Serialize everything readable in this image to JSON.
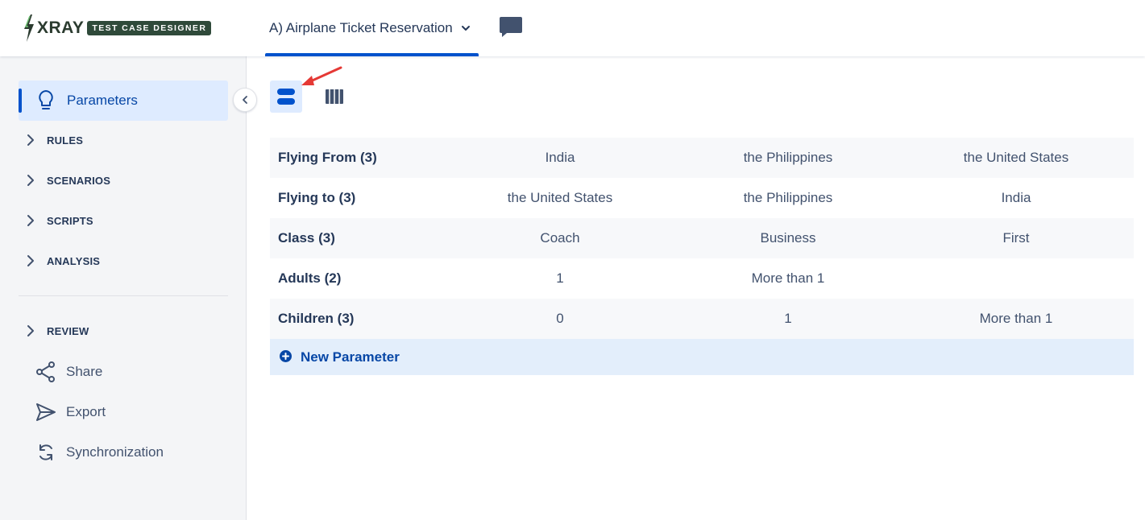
{
  "app": {
    "logo_main": "XRAY",
    "logo_sub": "TEST CASE DESIGNER"
  },
  "header": {
    "project_title": "A) Airplane Ticket Reservation"
  },
  "sidebar": {
    "active_item": "Parameters",
    "sections": [
      {
        "label": "RULES"
      },
      {
        "label": "SCENARIOS"
      },
      {
        "label": "SCRIPTS"
      },
      {
        "label": "ANALYSIS"
      },
      {
        "label": "REVIEW"
      }
    ],
    "items": [
      {
        "label": "Share",
        "icon": "share-icon"
      },
      {
        "label": "Export",
        "icon": "send-icon"
      },
      {
        "label": "Synchronization",
        "icon": "sync-icon"
      }
    ]
  },
  "parameters": {
    "rows": [
      {
        "name": "Flying From (3)",
        "values": [
          "India",
          "the Philippines",
          "the United States"
        ]
      },
      {
        "name": "Flying to (3)",
        "values": [
          "the United States",
          "the Philippines",
          "India"
        ]
      },
      {
        "name": "Class (3)",
        "values": [
          "Coach",
          "Business",
          "First"
        ]
      },
      {
        "name": "Adults (2)",
        "values": [
          "1",
          "More than 1",
          ""
        ]
      },
      {
        "name": "Children (3)",
        "values": [
          "0",
          "1",
          "More than 1"
        ]
      }
    ],
    "new_label": "New Parameter"
  },
  "colors": {
    "accent": "#0052cc",
    "active_bg": "#deebff",
    "annotation_arrow": "#e53935"
  }
}
